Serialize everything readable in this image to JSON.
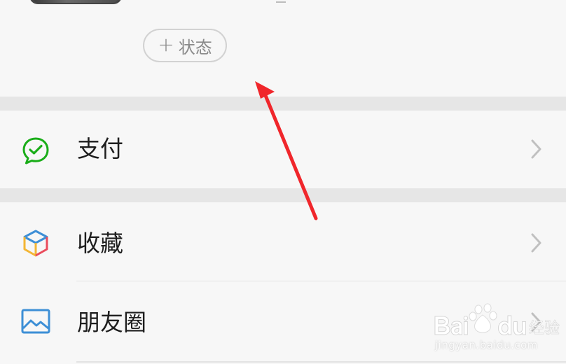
{
  "profile": {
    "status_button": {
      "plus": "+",
      "label": "状态"
    }
  },
  "rows": [
    {
      "label": "支付",
      "icon": "wechat-pay-icon",
      "icon_color": "#1aad19"
    },
    {
      "label": "收藏",
      "icon": "favorites-cube-icon",
      "icon_color": "#f3b635"
    },
    {
      "label": "朋友圈",
      "icon": "moments-image-icon",
      "icon_color": "#3d8fd6"
    }
  ],
  "colors": {
    "background": "#f7f7f7",
    "separator": "#e6e6e6",
    "annotation": "#f0262b",
    "chevron": "#c0c0c0"
  },
  "watermark": {
    "url": "jingyan.baidu.com"
  }
}
